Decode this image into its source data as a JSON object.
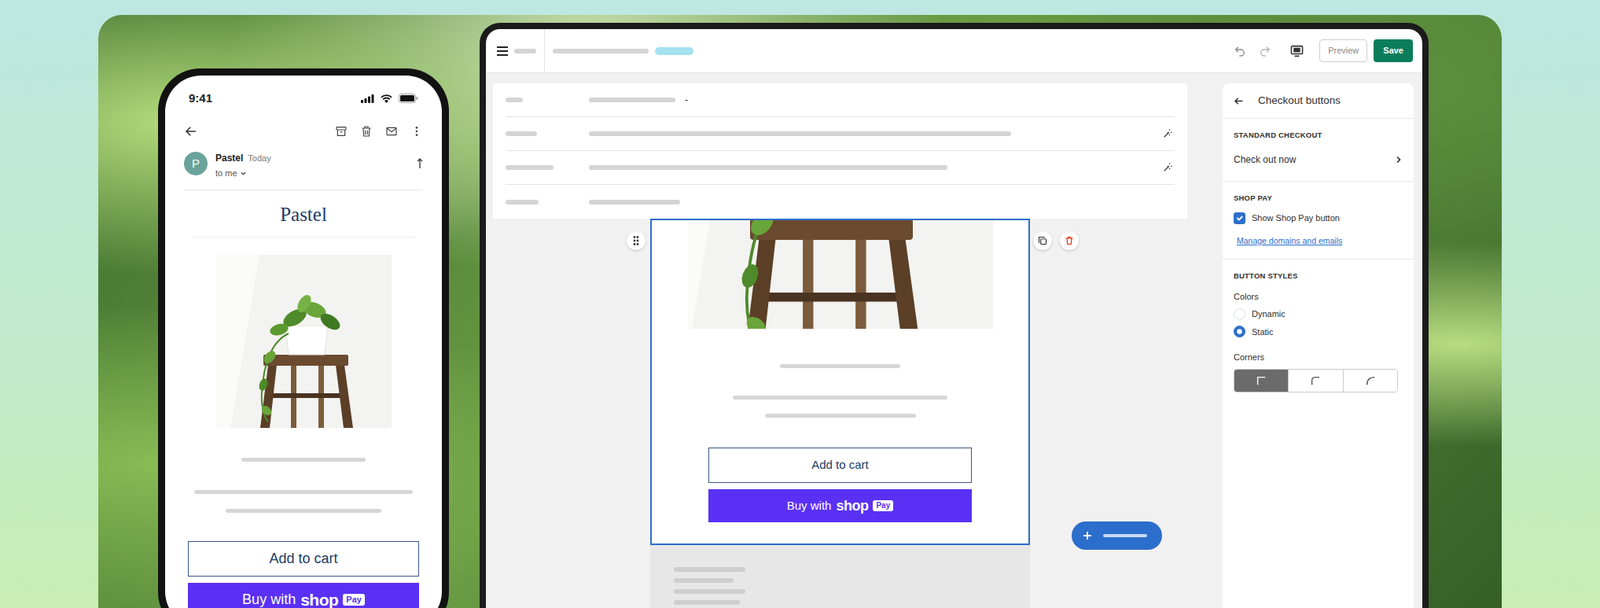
{
  "phone": {
    "time": "9:41",
    "sender_initial": "P",
    "sender": "Pastel",
    "date": "Today",
    "recipient": "to me",
    "brand": "Pastel",
    "add_to_cart": "Add to cart",
    "buy_button": {
      "prefix": "Buy with",
      "brand": "shop",
      "badge": "Pay"
    }
  },
  "editor": {
    "toolbar": {
      "preview": "Preview",
      "save": "Save"
    },
    "settings_rows": [
      {
        "kind": "plain",
        "suffix": "-"
      },
      {
        "kind": "generated"
      },
      {
        "kind": "generated"
      },
      {
        "kind": "plain"
      }
    ],
    "canvas": {
      "add_to_cart": "Add to cart",
      "buy_button": {
        "prefix": "Buy with",
        "brand": "shop",
        "badge": "Pay"
      }
    },
    "panel": {
      "title": "Checkout buttons",
      "standard_checkout": {
        "heading": "STANDARD CHECKOUT",
        "link": "Check out now"
      },
      "shop_pay": {
        "heading": "SHOP PAY",
        "checkbox": {
          "label": "Show Shop Pay button",
          "checked": true
        },
        "link": "Manage domains and emails"
      },
      "button_styles": {
        "heading": "BUTTON STYLES",
        "colors_label": "Colors",
        "colors": [
          {
            "label": "Dynamic",
            "selected": false
          },
          {
            "label": "Static",
            "selected": true
          }
        ],
        "corners_label": "Corners",
        "corners": [
          {
            "kind": "square",
            "selected": true
          },
          {
            "kind": "rounded",
            "selected": false
          },
          {
            "kind": "round",
            "selected": false
          }
        ]
      }
    }
  }
}
